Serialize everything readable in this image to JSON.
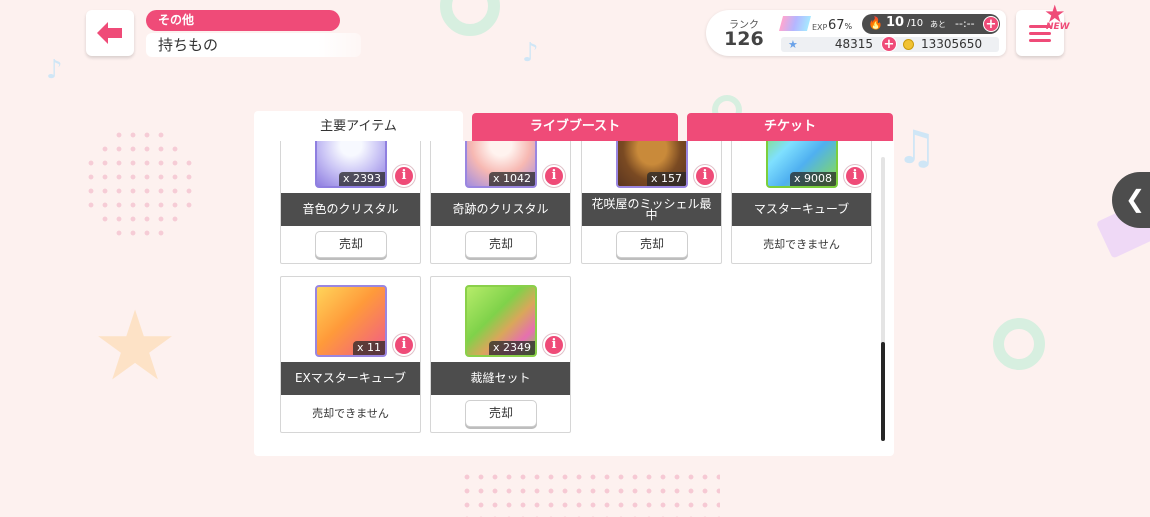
{
  "header": {
    "category": "その他",
    "title": "持ちもの"
  },
  "status": {
    "rank_label": "ランク",
    "rank": "126",
    "exp_label": "EXP",
    "exp_value": "67",
    "exp_unit": "%",
    "stamina_current": "10",
    "stamina_max": "/10",
    "stamina_next_label": "あと",
    "stamina_timer": "--:--",
    "gems": "48315",
    "coins": "13305650"
  },
  "menu": {
    "new_badge": "NEW"
  },
  "tabs": [
    {
      "label": "主要アイテム",
      "active": true
    },
    {
      "label": "ライブブースト",
      "active": false
    },
    {
      "label": "チケット",
      "active": false
    }
  ],
  "items": [
    {
      "name": "音色のクリスタル",
      "qty": "x 2393",
      "sell_label": "売却",
      "sellable": true
    },
    {
      "name": "奇跡のクリスタル",
      "qty": "x 1042",
      "sell_label": "売却",
      "sellable": true
    },
    {
      "name": "花咲屋のミッシェル最中",
      "qty": "x 157",
      "sell_label": "売却",
      "sellable": true
    },
    {
      "name": "マスターキューブ",
      "qty": "x 9008",
      "sell_label": "売却できません",
      "sellable": false
    },
    {
      "name": "EXマスターキューブ",
      "qty": "x 11",
      "sell_label": "売却できません",
      "sellable": false
    },
    {
      "name": "裁縫セット",
      "qty": "x 2349",
      "sell_label": "売却",
      "sellable": true
    }
  ],
  "colors": {
    "accent": "#ef4b78",
    "dark_label": "#4d4d4d",
    "background": "#fdf1ef"
  },
  "icons": {
    "back": "arrow-left-icon",
    "menu": "hamburger-icon",
    "info": "info-icon",
    "side": "chevron-left-icon"
  }
}
